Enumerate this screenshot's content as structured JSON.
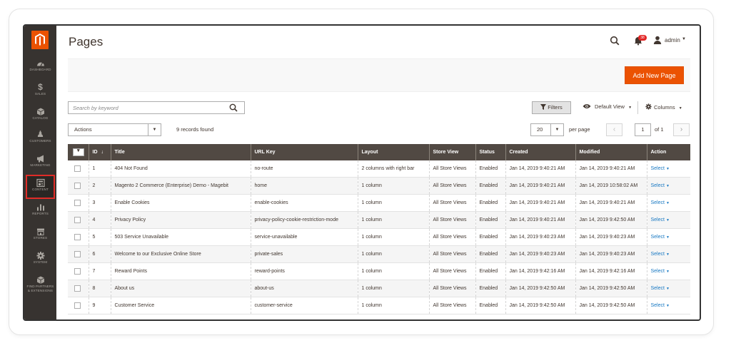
{
  "sidebar": {
    "items": [
      {
        "label": "DASHBOARD",
        "icon": "dashboard-icon"
      },
      {
        "label": "SALES",
        "icon": "dollar-icon"
      },
      {
        "label": "CATALOG",
        "icon": "box-icon"
      },
      {
        "label": "CUSTOMERS",
        "icon": "person-icon"
      },
      {
        "label": "MARKETING",
        "icon": "megaphone-icon"
      },
      {
        "label": "CONTENT",
        "icon": "content-icon",
        "active": true
      },
      {
        "label": "REPORTS",
        "icon": "bar-chart-icon"
      },
      {
        "label": "STORES",
        "icon": "store-icon"
      },
      {
        "label": "SYSTEM",
        "icon": "gear-icon"
      },
      {
        "label": "FIND PARTNERS & EXTENSIONS",
        "icon": "cube-icon"
      }
    ],
    "symbols": {
      "sales": "$",
      "customers": "♟"
    }
  },
  "header": {
    "title": "Pages",
    "notification_count": "38",
    "user": "admin"
  },
  "actions": {
    "add_new_page": "Add New Page"
  },
  "toolbar": {
    "search_placeholder": "Search by keyword",
    "filters": "Filters",
    "view": "Default View",
    "columns": "Columns",
    "mass_actions": "Actions",
    "records_found": "9 records found",
    "per_page_value": "20",
    "per_page_label": "per page",
    "page_current": "1",
    "page_total": "of 1"
  },
  "table": {
    "columns": [
      "ID",
      "Title",
      "URL Key",
      "Layout",
      "Store View",
      "Status",
      "Created",
      "Modified",
      "Action"
    ],
    "sort_arrow": "↓",
    "rows": [
      {
        "id": "1",
        "title": "404 Not Found",
        "url_key": "no-route",
        "layout": "2 columns with right bar",
        "store_view": "All Store Views",
        "status": "Enabled",
        "created": "Jan 14, 2019 9:40:21 AM",
        "modified": "Jan 14, 2019 9:40:21 AM",
        "action": "Select"
      },
      {
        "id": "2",
        "title": "Magento 2 Commerce (Enterprise) Demo - Magebit",
        "url_key": "home",
        "layout": "1 column",
        "store_view": "All Store Views",
        "status": "Enabled",
        "created": "Jan 14, 2019 9:40:21 AM",
        "modified": "Jan 14, 2019 10:58:02 AM",
        "action": "Select"
      },
      {
        "id": "3",
        "title": "Enable Cookies",
        "url_key": "enable-cookies",
        "layout": "1 column",
        "store_view": "All Store Views",
        "status": "Enabled",
        "created": "Jan 14, 2019 9:40:21 AM",
        "modified": "Jan 14, 2019 9:40:21 AM",
        "action": "Select"
      },
      {
        "id": "4",
        "title": "Privacy Policy",
        "url_key": "privacy-policy-cookie-restriction-mode",
        "layout": "1 column",
        "store_view": "All Store Views",
        "status": "Enabled",
        "created": "Jan 14, 2019 9:40:21 AM",
        "modified": "Jan 14, 2019 9:42:50 AM",
        "action": "Select"
      },
      {
        "id": "5",
        "title": "503 Service Unavailable",
        "url_key": "service-unavailable",
        "layout": "1 column",
        "store_view": "All Store Views",
        "status": "Enabled",
        "created": "Jan 14, 2019 9:40:23 AM",
        "modified": "Jan 14, 2019 9:40:23 AM",
        "action": "Select"
      },
      {
        "id": "6",
        "title": "Welcome to our Exclusive Online Store",
        "url_key": "private-sales",
        "layout": "1 column",
        "store_view": "All Store Views",
        "status": "Enabled",
        "created": "Jan 14, 2019 9:40:23 AM",
        "modified": "Jan 14, 2019 9:40:23 AM",
        "action": "Select"
      },
      {
        "id": "7",
        "title": "Reward Points",
        "url_key": "reward-points",
        "layout": "1 column",
        "store_view": "All Store Views",
        "status": "Enabled",
        "created": "Jan 14, 2019 9:42:16 AM",
        "modified": "Jan 14, 2019 9:42:16 AM",
        "action": "Select"
      },
      {
        "id": "8",
        "title": "About us",
        "url_key": "about-us",
        "layout": "1 column",
        "store_view": "All Store Views",
        "status": "Enabled",
        "created": "Jan 14, 2019 9:42:50 AM",
        "modified": "Jan 14, 2019 9:42:50 AM",
        "action": "Select"
      },
      {
        "id": "9",
        "title": "Customer Service",
        "url_key": "customer-service",
        "layout": "1 column",
        "store_view": "All Store Views",
        "status": "Enabled",
        "created": "Jan 14, 2019 9:42:50 AM",
        "modified": "Jan 14, 2019 9:42:50 AM",
        "action": "Select"
      }
    ]
  },
  "colors": {
    "accent": "#eb5202",
    "sidebar_bg": "#373330",
    "table_header_bg": "#514943",
    "active_outline": "#e02b27",
    "link": "#1979c3"
  }
}
